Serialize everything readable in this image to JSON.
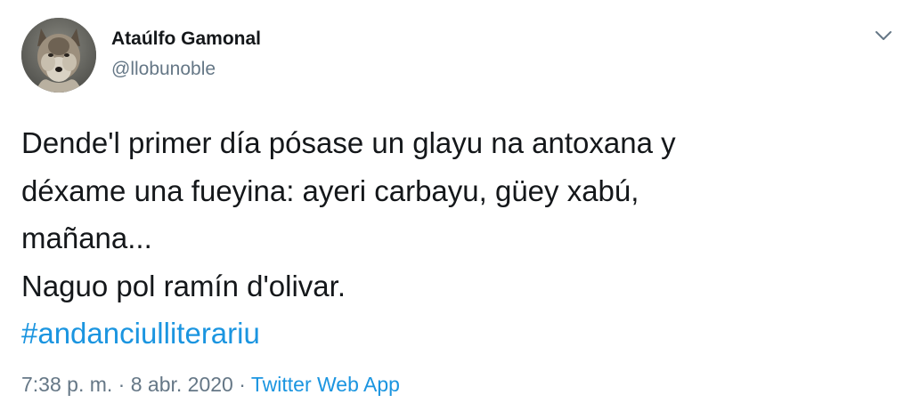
{
  "author": {
    "name": "Ataúlfo Gamonal",
    "handle": "@llobunoble",
    "avatar_icon": "wolf-avatar"
  },
  "menu": {
    "icon": "chevron-down-icon"
  },
  "tweet": {
    "lines": [
      "Dende'l primer día pósase un glayu na antoxana y",
      "déxame una fueyina: ayeri carbayu, güey xabú,",
      "mañana...",
      "Naguo pol ramín d'olivar."
    ],
    "hashtag": "#andanciulliterariu"
  },
  "meta": {
    "time": "7:38 p. m.",
    "separator_1": " · ",
    "date": "8 abr. 2020",
    "separator_2": " · ",
    "source": "Twitter Web App"
  },
  "colors": {
    "text": "#14171a",
    "secondary": "#657786",
    "link": "#1b95e0",
    "background": "#ffffff"
  }
}
